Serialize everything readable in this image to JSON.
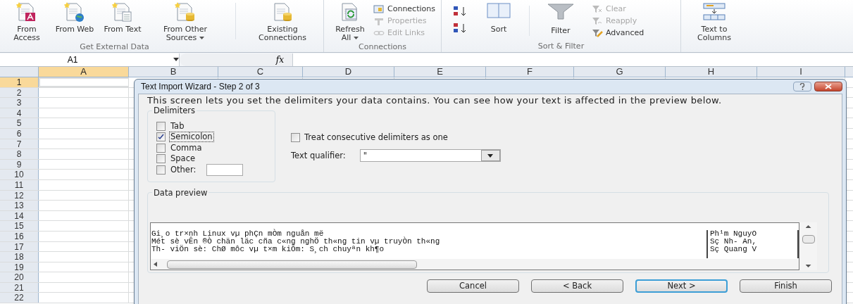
{
  "ribbon": {
    "groups": [
      {
        "label": "Get External Data",
        "items": [
          {
            "kind": "access",
            "label": "From Access",
            "dropdown": false
          },
          {
            "kind": "web",
            "label": "From Web",
            "dropdown": false
          },
          {
            "kind": "text",
            "label": "From Text",
            "dropdown": false
          },
          {
            "kind": "other",
            "label": "From Other Sources",
            "dropdown": true
          }
        ],
        "extra": {
          "kind": "existing",
          "label": "Existing Connections",
          "dropdown": false
        }
      },
      {
        "label": "Connections",
        "items": [
          {
            "kind": "refresh",
            "label": "Refresh All",
            "dropdown": true
          }
        ],
        "small": [
          {
            "kind": "connections",
            "label": "Connections",
            "disabled": false
          },
          {
            "kind": "properties",
            "label": "Properties",
            "disabled": true
          },
          {
            "kind": "links",
            "label": "Edit Links",
            "disabled": true
          }
        ]
      },
      {
        "label": "Sort & Filter",
        "sort_label": "Sort",
        "filter_label": "Filter",
        "small": [
          {
            "kind": "clear",
            "label": "Clear",
            "disabled": true
          },
          {
            "kind": "reapply",
            "label": "Reapply",
            "disabled": true
          },
          {
            "kind": "advanced",
            "label": "Advanced",
            "disabled": false
          }
        ]
      },
      {
        "items": [
          {
            "kind": "columns",
            "label": "Text to Columns",
            "dropdown": false
          }
        ]
      }
    ]
  },
  "formula_bar": {
    "name_box": "A1",
    "fx_label": "fx"
  },
  "sheet": {
    "columns": [
      {
        "label": "A",
        "selected": true
      },
      {
        "label": "B",
        "selected": false
      },
      {
        "label": "C",
        "selected": false
      },
      {
        "label": "D",
        "selected": false
      },
      {
        "label": "E",
        "selected": false
      },
      {
        "label": "F",
        "selected": false
      },
      {
        "label": "G",
        "selected": false
      },
      {
        "label": "H",
        "selected": false
      },
      {
        "label": "I",
        "selected": false
      }
    ],
    "rows": [
      {
        "label": "1",
        "selected": true
      },
      {
        "label": "2",
        "selected": false
      },
      {
        "label": "3",
        "selected": false
      },
      {
        "label": "4",
        "selected": false
      },
      {
        "label": "5",
        "selected": false
      },
      {
        "label": "6",
        "selected": false
      },
      {
        "label": "7",
        "selected": false
      },
      {
        "label": "8",
        "selected": false
      },
      {
        "label": "9",
        "selected": false
      },
      {
        "label": "10",
        "selected": false
      },
      {
        "label": "11",
        "selected": false
      },
      {
        "label": "12",
        "selected": false
      },
      {
        "label": "13",
        "selected": false
      },
      {
        "label": "14",
        "selected": false
      },
      {
        "label": "15",
        "selected": false
      },
      {
        "label": "16",
        "selected": false
      },
      {
        "label": "17",
        "selected": false
      },
      {
        "label": "18",
        "selected": false
      },
      {
        "label": "19",
        "selected": false
      },
      {
        "label": "20",
        "selected": false
      },
      {
        "label": "21",
        "selected": false
      },
      {
        "label": "22",
        "selected": false
      }
    ]
  },
  "dialog": {
    "title": "Text Import Wizard - Step 2 of 3",
    "description": "This screen lets you set the delimiters your data contains.  You can see how your text is affected in the preview below.",
    "delimiters_label": "Delimiters",
    "delimiters": [
      {
        "label": "Tab",
        "checked": false,
        "focused": false,
        "kind": "plain"
      },
      {
        "label": "Semicolon",
        "checked": true,
        "focused": true,
        "kind": "plain"
      },
      {
        "label": "Comma",
        "checked": false,
        "focused": false,
        "kind": "plain"
      },
      {
        "label": "Space",
        "checked": false,
        "focused": false,
        "kind": "plain"
      },
      {
        "label": "Other:",
        "checked": false,
        "focused": false,
        "kind": "other"
      }
    ],
    "consecutive": {
      "label": "Treat consecutive delimiters as one",
      "checked": false
    },
    "qualifier": {
      "label": "Text qualifier:",
      "value": "\""
    },
    "preview_label": "Data preview",
    "preview_rows": [
      [
        "Gi¸o tr×nh Linux vµ phÇn mÒm nguån më",
        "Ph¹m NguyÔ"
      ],
      [
        "Mét sè vÊn ®Ò chän läc cña c«ng nghÖ th«ng tin vµ truyÒn th«ng",
        "Sç Nh- An,"
      ],
      [
        "Th- viÖn sè: ChØ môc vµ t×m kiÕm: S¸ch chuyªn kh¶o",
        "Sç Quang V"
      ]
    ],
    "buttons": [
      {
        "label": "Cancel",
        "default": false
      },
      {
        "label": "< Back",
        "default": false
      },
      {
        "label": "Next >",
        "default": true
      },
      {
        "label": "Finish",
        "default": false
      }
    ]
  }
}
